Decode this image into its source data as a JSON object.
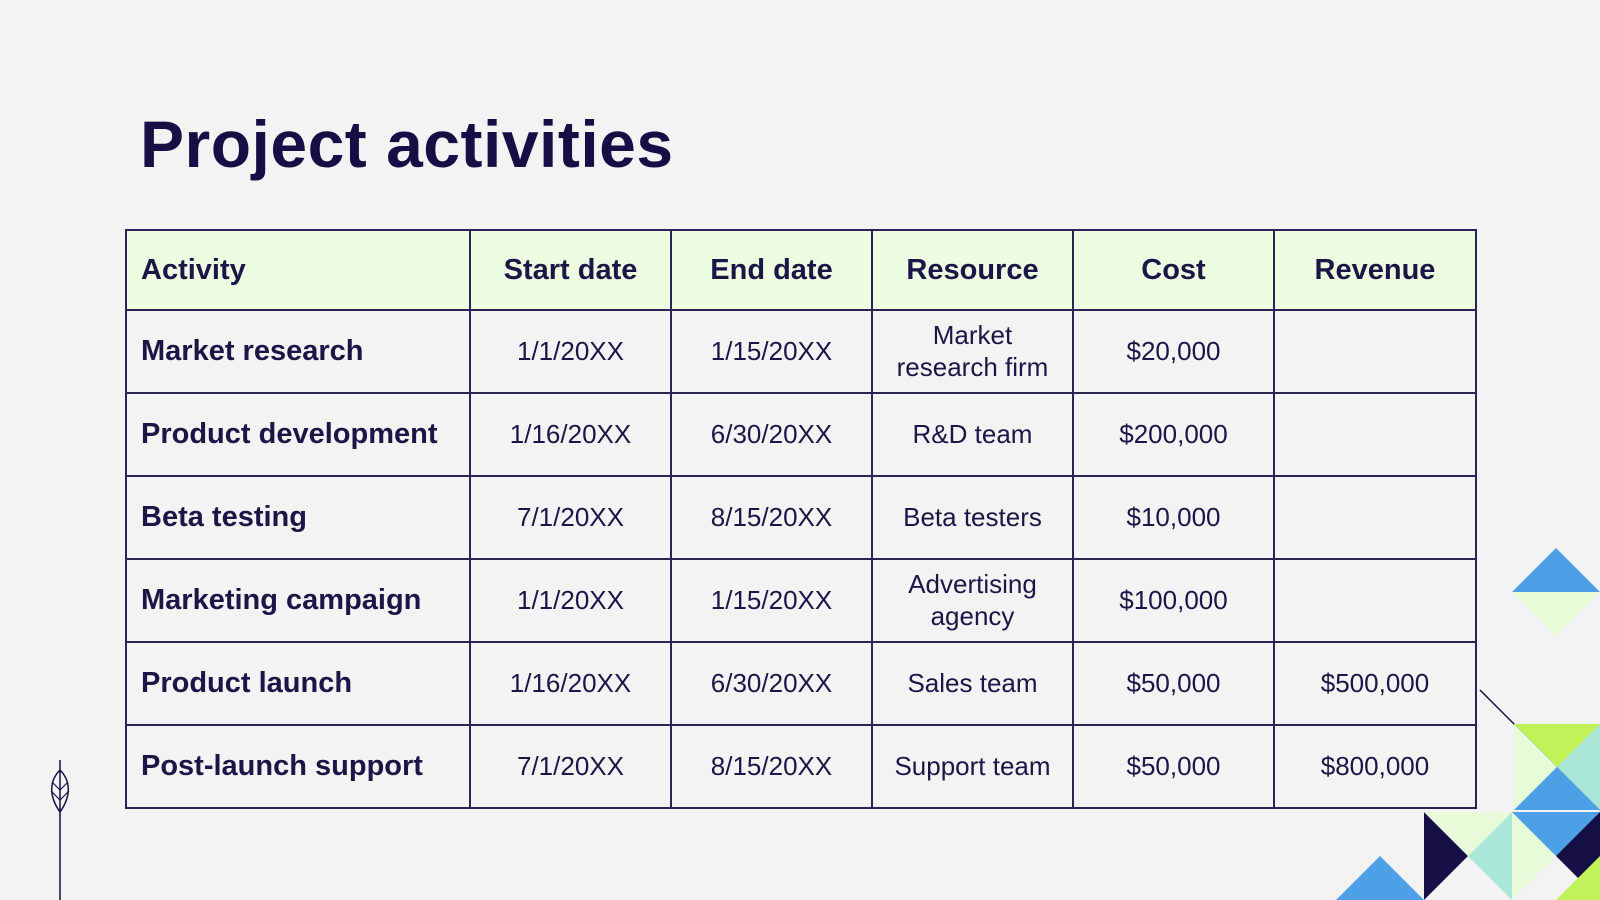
{
  "title": "Project activities",
  "table": {
    "headers": [
      "Activity",
      "Start date",
      "End date",
      "Resource",
      "Cost",
      "Revenue"
    ],
    "rows": [
      [
        "Market research",
        "1/1/20XX",
        "1/15/20XX",
        "Market research firm",
        "$20,000",
        ""
      ],
      [
        "Product development",
        "1/16/20XX",
        "6/30/20XX",
        "R&D team",
        "$200,000",
        ""
      ],
      [
        "Beta testing",
        "7/1/20XX",
        "8/15/20XX",
        "Beta testers",
        "$10,000",
        ""
      ],
      [
        "Marketing campaign",
        "1/1/20XX",
        "1/15/20XX",
        "Advertising agency",
        "$100,000",
        ""
      ],
      [
        "Product launch",
        "1/16/20XX",
        "6/30/20XX",
        "Sales team",
        "$50,000",
        "$500,000"
      ],
      [
        "Post-launch support",
        "7/1/20XX",
        "8/15/20XX",
        "Support team",
        "$50,000",
        "$800,000"
      ]
    ]
  },
  "decorations": {
    "leaf": "leaf-icon",
    "corner": "geometric-triangles"
  },
  "colors": {
    "background": "#f3f3f3",
    "text": "#160f45",
    "header_fill": "#ecfde1",
    "border": "#2a2455",
    "blue": "#4ea0e6",
    "lime": "#c2f25a",
    "mint": "#a9e6d8",
    "pale_green": "#e7fbd8",
    "navy": "#160f45"
  }
}
